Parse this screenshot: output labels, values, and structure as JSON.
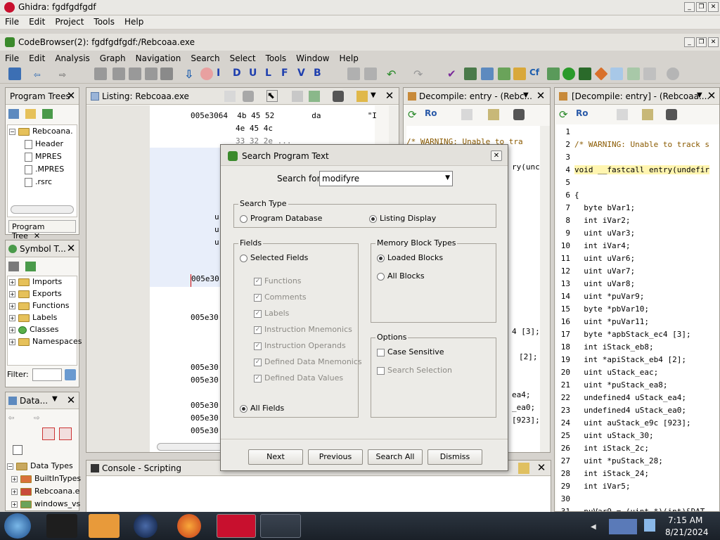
{
  "app": {
    "title": "Ghidra: fgdfgdfgdf",
    "menu": [
      "File",
      "Edit",
      "Project",
      "Tools",
      "Help"
    ]
  },
  "codebrowser": {
    "title": "CodeBrowser(2): fgdfgdfgdf:/Rebcoaa.exe",
    "menu": [
      "File",
      "Edit",
      "Analysis",
      "Graph",
      "Navigation",
      "Search",
      "Select",
      "Tools",
      "Window",
      "Help"
    ]
  },
  "program_trees": {
    "title": "Program Trees",
    "root": "Rebcoana.",
    "children": [
      "Header",
      "MPRES",
      ".MPRES",
      ".rsrc"
    ],
    "tab": "Program Tree"
  },
  "symbol_tree": {
    "title": "Symbol T...",
    "items": [
      "Imports",
      "Exports",
      "Functions",
      "Labels",
      "Classes",
      "Namespaces"
    ],
    "filter_label": "Filter:"
  },
  "data_types": {
    "title": "Data...",
    "root": "Data Types",
    "items": [
      "BuiltInTypes",
      "Rebcoana.e",
      "windows_vs"
    ]
  },
  "listing": {
    "title": "Listing:  Rebcoaa.exe",
    "lines": [
      {
        "addr": "005e3064",
        "bytes": "4b 45 52",
        "mn": "da",
        "op": "\"I"
      },
      {
        "addr": "",
        "bytes": "4e 45 4c",
        "mn": "",
        "op": ""
      },
      {
        "addr": "",
        "bytes": "33 32 2e ...",
        "mn": "",
        "op": ""
      }
    ],
    "addr_fragments": [
      "ur",
      "ur",
      "ur",
      "005e30",
      "005e30",
      "005e30",
      "005e30",
      "005e30",
      "005e30",
      "005e30"
    ]
  },
  "decompile1": {
    "title": "Decompile: entry - (Rebc...",
    "fragments": [
      "/* WARNING: Unable to tra",
      "ry(unc",
      "4 [3];",
      "[2];",
      "ea4;",
      "_ea0;",
      "[923];"
    ]
  },
  "decompile2": {
    "title": "[Decompile: entry] - (Rebcoaa....",
    "lines": [
      {
        "n": "1",
        "t": ""
      },
      {
        "n": "2",
        "t": "/* WARNING: Unable to track s"
      },
      {
        "n": "3",
        "t": ""
      },
      {
        "n": "4",
        "t": "void __fastcall entry(undefir"
      },
      {
        "n": "5",
        "t": ""
      },
      {
        "n": "6",
        "t": "{"
      },
      {
        "n": "7",
        "t": "  byte bVar1;"
      },
      {
        "n": "8",
        "t": "  int iVar2;"
      },
      {
        "n": "9",
        "t": "  uint uVar3;"
      },
      {
        "n": "10",
        "t": "  int iVar4;"
      },
      {
        "n": "11",
        "t": "  uint uVar6;"
      },
      {
        "n": "12",
        "t": "  uint uVar7;"
      },
      {
        "n": "13",
        "t": "  uint uVar8;"
      },
      {
        "n": "14",
        "t": "  uint *puVar9;"
      },
      {
        "n": "15",
        "t": "  byte *pbVar10;"
      },
      {
        "n": "16",
        "t": "  uint *puVar11;"
      },
      {
        "n": "17",
        "t": "  byte *apbStack_ec4 [3];"
      },
      {
        "n": "18",
        "t": "  int iStack_eb8;"
      },
      {
        "n": "19",
        "t": "  int *apiStack_eb4 [2];"
      },
      {
        "n": "20",
        "t": "  uint uStack_eac;"
      },
      {
        "n": "21",
        "t": "  uint *puStack_ea8;"
      },
      {
        "n": "22",
        "t": "  undefined4 uStack_ea4;"
      },
      {
        "n": "23",
        "t": "  undefined4 uStack_ea0;"
      },
      {
        "n": "24",
        "t": "  uint auStack_e9c [923];"
      },
      {
        "n": "25",
        "t": "  uint uStack_30;"
      },
      {
        "n": "26",
        "t": "  int iStack_2c;"
      },
      {
        "n": "27",
        "t": "  uint *puStack_28;"
      },
      {
        "n": "28",
        "t": "  int iStack_24;"
      },
      {
        "n": "29",
        "t": "  int iVar5;"
      },
      {
        "n": "30",
        "t": ""
      },
      {
        "n": "31",
        "t": "  puVar9 = (uint *)(int)&DAT"
      }
    ]
  },
  "console": {
    "title": "Console - Scripting"
  },
  "dialog": {
    "title": "Search Program Text",
    "search_label": "Search for:",
    "search_value": "modifyre",
    "search_type": {
      "label": "Search Type",
      "program_db": "Program Database",
      "listing_display": "Listing Display"
    },
    "fields": {
      "label": "Fields",
      "selected": "Selected Fields",
      "options": [
        "Functions",
        "Comments",
        "Labels",
        "Instruction Mnemonics",
        "Instruction Operands",
        "Defined Data Mnemonics",
        "Defined Data Values"
      ],
      "all": "All Fields"
    },
    "memory": {
      "label": "Memory Block Types",
      "loaded": "Loaded Blocks",
      "all": "All Blocks"
    },
    "options": {
      "label": "Options",
      "case": "Case Sensitive",
      "selection": "Search Selection"
    },
    "buttons": {
      "next": "Next",
      "previous": "Previous",
      "search_all": "Search All",
      "dismiss": "Dismiss"
    }
  },
  "taskbar": {
    "time": "7:15 AM",
    "date": "8/21/2024"
  },
  "colors": {
    "accent": "#cc0000",
    "decomp_var": "#8a5a00",
    "selection": "#e8eefa"
  }
}
